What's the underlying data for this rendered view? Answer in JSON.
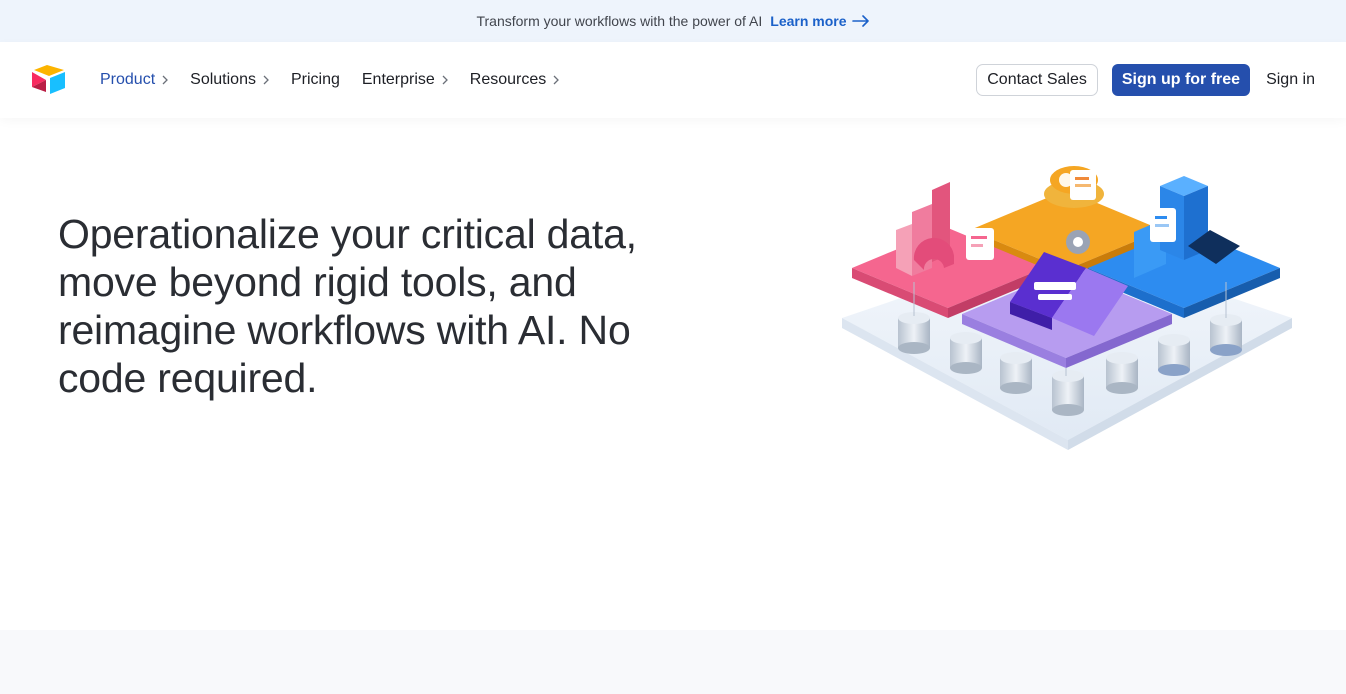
{
  "announcement": {
    "text": "Transform your workflows with the power of AI",
    "link_label": "Learn more",
    "link_icon": "arrow-right-icon"
  },
  "nav": {
    "logo_icon": "airtable-logo",
    "items": [
      {
        "label": "Product",
        "has_chevron": true,
        "active": true
      },
      {
        "label": "Solutions",
        "has_chevron": true
      },
      {
        "label": "Pricing",
        "has_chevron": false
      },
      {
        "label": "Enterprise",
        "has_chevron": true
      },
      {
        "label": "Resources",
        "has_chevron": true
      }
    ],
    "contact_sales": "Contact Sales",
    "signup": "Sign up for free",
    "signin": "Sign in"
  },
  "hero": {
    "title": "Operationalize your critical data, move beyond rigid tools, and reimagine workflows with AI. No code required.",
    "illustration": "isometric-data-platform-illustration"
  },
  "colors": {
    "accent": "#254fad",
    "link": "#1b61c9",
    "banner_bg": "#eef4fc",
    "pink": "#f0668f",
    "orange": "#f5a623",
    "blue": "#2d8cf0",
    "purple": "#7b4fe0"
  }
}
